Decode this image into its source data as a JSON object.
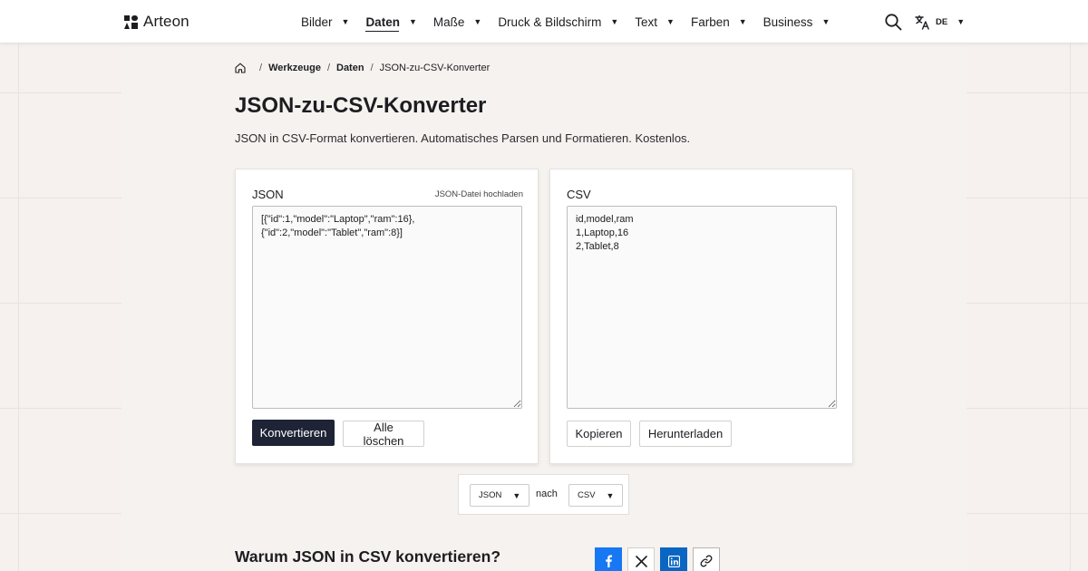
{
  "header": {
    "brand": "Arteon",
    "nav": [
      {
        "label": "Bilder",
        "active": false
      },
      {
        "label": "Daten",
        "active": true
      },
      {
        "label": "Maße",
        "active": false
      },
      {
        "label": "Druck & Bildschirm",
        "active": false
      },
      {
        "label": "Text",
        "active": false
      },
      {
        "label": "Farben",
        "active": false
      },
      {
        "label": "Business",
        "active": false
      }
    ],
    "language": "DE",
    "caret": "▼"
  },
  "breadcrumb": {
    "items": [
      "Werkzeuge",
      "Daten"
    ],
    "current": "JSON-zu-CSV-Konverter",
    "separator": "/"
  },
  "page": {
    "title": "JSON-zu-CSV-Konverter",
    "subtitle": "JSON in CSV-Format konvertieren. Automatisches Parsen und Formatieren. Kostenlos."
  },
  "input_panel": {
    "label": "JSON",
    "upload_link": "JSON-Datei hochladen",
    "value": "[{\"id\":1,\"model\":\"Laptop\",\"ram\":16},\n{\"id\":2,\"model\":\"Tablet\",\"ram\":8}]",
    "convert_label": "Konvertieren",
    "clear_label": "Alle löschen"
  },
  "output_panel": {
    "label": "CSV",
    "value": "id,model,ram\n1,Laptop,16\n2,Tablet,8",
    "copy_label": "Kopieren",
    "download_label": "Herunterladen"
  },
  "format_bar": {
    "from": "JSON",
    "to_word": "nach",
    "to": "CSV"
  },
  "section": {
    "heading": "Warum JSON in CSV konvertieren?"
  },
  "colors": {
    "accent_dark": "#1f2336",
    "facebook": "#1877f2",
    "linkedin": "#0a66c2"
  },
  "icons": {
    "search": "search-icon",
    "language": "translate-icon",
    "home": "home-icon",
    "facebook": "facebook-icon",
    "x": "x-icon",
    "linkedin": "linkedin-icon",
    "link": "link-icon"
  }
}
